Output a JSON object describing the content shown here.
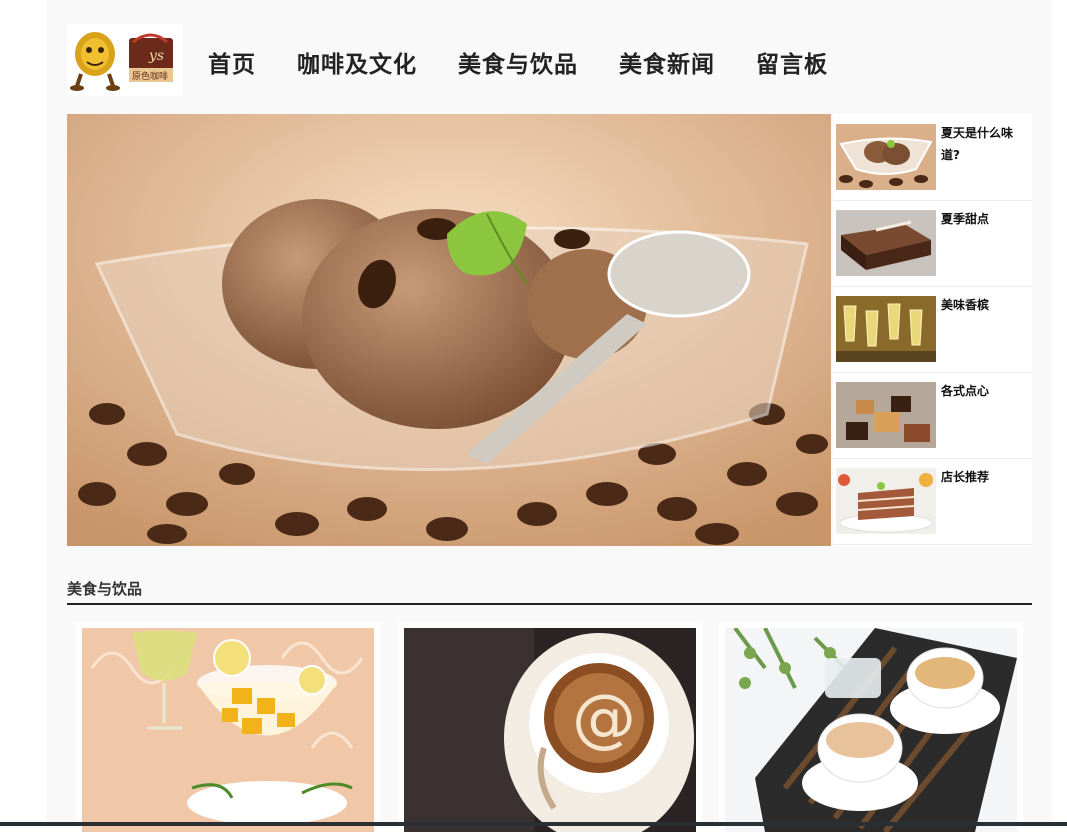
{
  "header": {
    "logo_alt": "coffee-mascot-logo",
    "nav": [
      "首页",
      "咖啡及文化",
      "美食与饮品",
      "美食新闻",
      "留言板"
    ]
  },
  "hero": {
    "image": "ice-cream-coffee-beans-photo"
  },
  "sidebar": {
    "items": [
      {
        "title": "夏天是什么味道?",
        "image": "ice-cream-bowl-photo"
      },
      {
        "title": "夏季甜点",
        "image": "chocolate-cake-photo"
      },
      {
        "title": "美味香槟",
        "image": "champagne-glasses-photo"
      },
      {
        "title": "各式点心",
        "image": "pastries-photo"
      },
      {
        "title": "店长推荐",
        "image": "layer-cake-photo"
      }
    ]
  },
  "section": {
    "title": "美食与饮品",
    "cards": [
      {
        "image": "fruit-dessert-photo"
      },
      {
        "image": "latte-art-coffee-photo"
      },
      {
        "image": "tea-cups-tray-photo"
      }
    ]
  },
  "colors": {
    "accent": "#222222",
    "page_bg": "#f9f9f9"
  }
}
